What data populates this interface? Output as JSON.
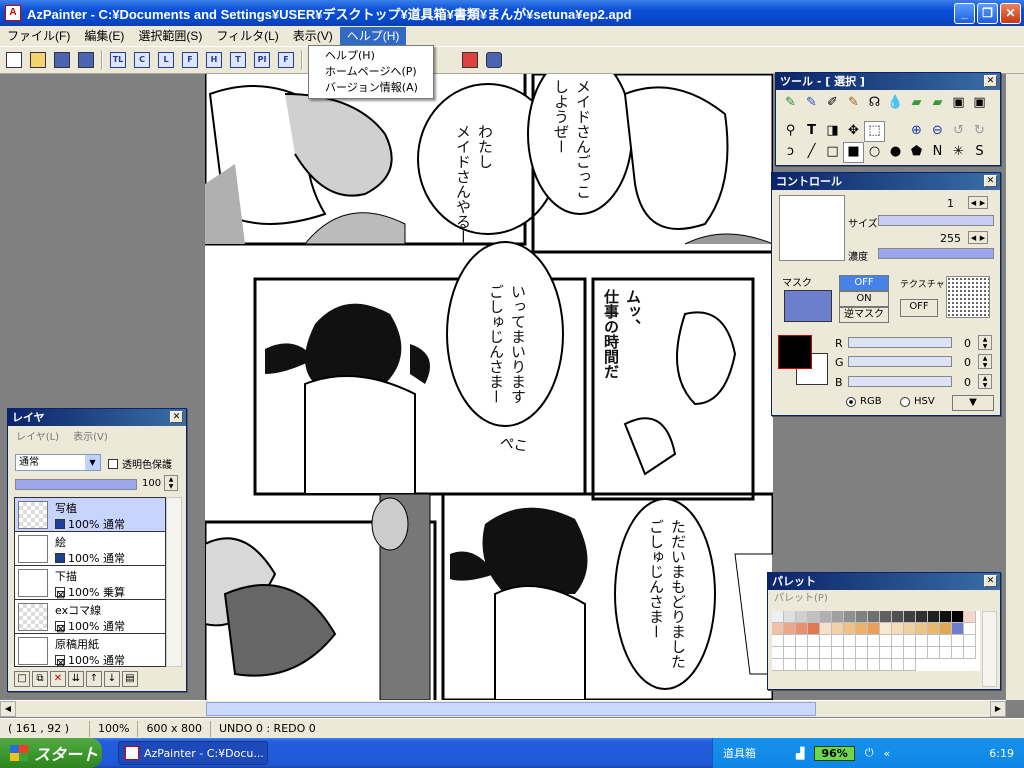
{
  "window": {
    "title": "AzPainter - C:¥Documents and Settings¥USER¥デスクトップ¥道具箱¥書類¥まんが¥setuna¥ep2.apd",
    "min_label": "_",
    "max_label": "❐",
    "close_label": "✕"
  },
  "menubar": {
    "items": [
      "ファイル(F)",
      "編集(E)",
      "選択範囲(S)",
      "フィルタ(L)",
      "表示(V)",
      "ヘルプ(H)"
    ]
  },
  "toolbar": {
    "doc_buttons": [
      "TL",
      "C",
      "L",
      "F",
      "H",
      "T",
      "PI",
      "F"
    ]
  },
  "help_menu": {
    "items": [
      "ヘルプ(H)",
      "ホームページへ(P)",
      "バージョン情報(A)"
    ]
  },
  "comic": {
    "bubble1": [
      "わたし",
      "メイドさんやるー"
    ],
    "bubble2": [
      "メイドさんごっこ",
      "しようぜー"
    ],
    "bubble3": [
      "いってまいります",
      "ごしゅじんさまー"
    ],
    "bubble4": [
      "ムッ、",
      "仕事の時間だ"
    ],
    "sfx": "ぺこ",
    "bubble5": [
      "ただいまもどりました",
      "ごしゅじんさまー"
    ]
  },
  "tool_panel": {
    "title": "ツール - [ 選択 ]",
    "close": "✕"
  },
  "control_panel": {
    "title": "コントロール",
    "close": "✕",
    "size_label": "サイズ",
    "size_value": "1",
    "density_label": "濃度",
    "density_value": "255",
    "mask_label": "マスク",
    "mask_off": "OFF",
    "mask_on": "ON",
    "mask_inverse": "逆マスク",
    "texture_label": "テクスチャ",
    "texture_off": "OFF",
    "r_label": "R",
    "r_value": "0",
    "g_label": "G",
    "g_value": "0",
    "b_label": "B",
    "b_value": "0",
    "rgb_label": "RGB",
    "hsv_label": "HSV",
    "colors": {
      "foreground": "#000000",
      "background": "#ffffff",
      "mask": "#6b7fcc"
    }
  },
  "layer_panel": {
    "title": "レイヤ",
    "close": "✕",
    "menu": [
      "レイヤ(L)",
      "表示(V)"
    ],
    "blend_mode": "通常",
    "preserve_alpha_label": "透明色保護",
    "opacity": "100",
    "layers": [
      {
        "name": "写植",
        "info": "100% 通常"
      },
      {
        "name": "絵",
        "info": "100% 通常"
      },
      {
        "name": "下描",
        "info": "100% 乗算"
      },
      {
        "name": "exコマ線",
        "info": "100% 通常"
      },
      {
        "name": "原稿用紙",
        "info": "100% 通常"
      }
    ]
  },
  "palette_panel": {
    "title": "パレット",
    "close": "✕",
    "menu": "パレット(P)",
    "colors": [
      "#f0f0f0",
      "#e0e0e0",
      "#d0d0d0",
      "#c0c0c0",
      "#b0b0b0",
      "#a0a0a0",
      "#909090",
      "#808080",
      "#707070",
      "#606060",
      "#505050",
      "#404040",
      "#303030",
      "#202020",
      "#101010",
      "#000000",
      "#f6d8c8",
      "#f0c0a8",
      "#eaa888",
      "#e89070",
      "#e07850",
      "#f8e0c8",
      "#f4d0a8",
      "#f0c088",
      "#eeb070",
      "#e8a058",
      "#f8e8d0",
      "#f4dcb8",
      "#f0d0a0",
      "#ecc488",
      "#e8b870",
      "#e0a850"
    ]
  },
  "statusbar": {
    "coords": "( 161 ,  92 )",
    "zoom": "100%",
    "canvas_size": "600 x 800",
    "undo": "UNDO   0 : REDO   0"
  },
  "taskbar": {
    "start": "スタート",
    "task": "AzPainter - C:¥Docu...",
    "toolbar_label": "道具箱",
    "battery": "96%",
    "time": "6:19"
  }
}
